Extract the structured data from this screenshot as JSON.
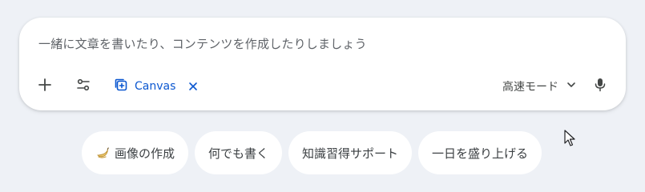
{
  "composer": {
    "placeholder": "一緒に文章を書いたり、コンテンツを作成したりしましょう",
    "toolbar": {
      "add_icon": "plus-icon",
      "tools_icon": "tune-icon",
      "canvas": {
        "label": "Canvas",
        "icon": "canvas-add-icon",
        "close_icon": "close-icon"
      },
      "mode": {
        "label": "高速モード",
        "icon": "chevron-down-icon"
      },
      "mic_icon": "microphone-icon"
    }
  },
  "suggestions": [
    {
      "label": "画像の作成",
      "icon": "banana-icon"
    },
    {
      "label": "何でも書く"
    },
    {
      "label": "知識習得サポート"
    },
    {
      "label": "一日を盛り上げる"
    }
  ],
  "colors": {
    "background": "#eef1f6",
    "accent": "#0b57d0",
    "text": "#3c4043",
    "muted": "#5f6368"
  }
}
